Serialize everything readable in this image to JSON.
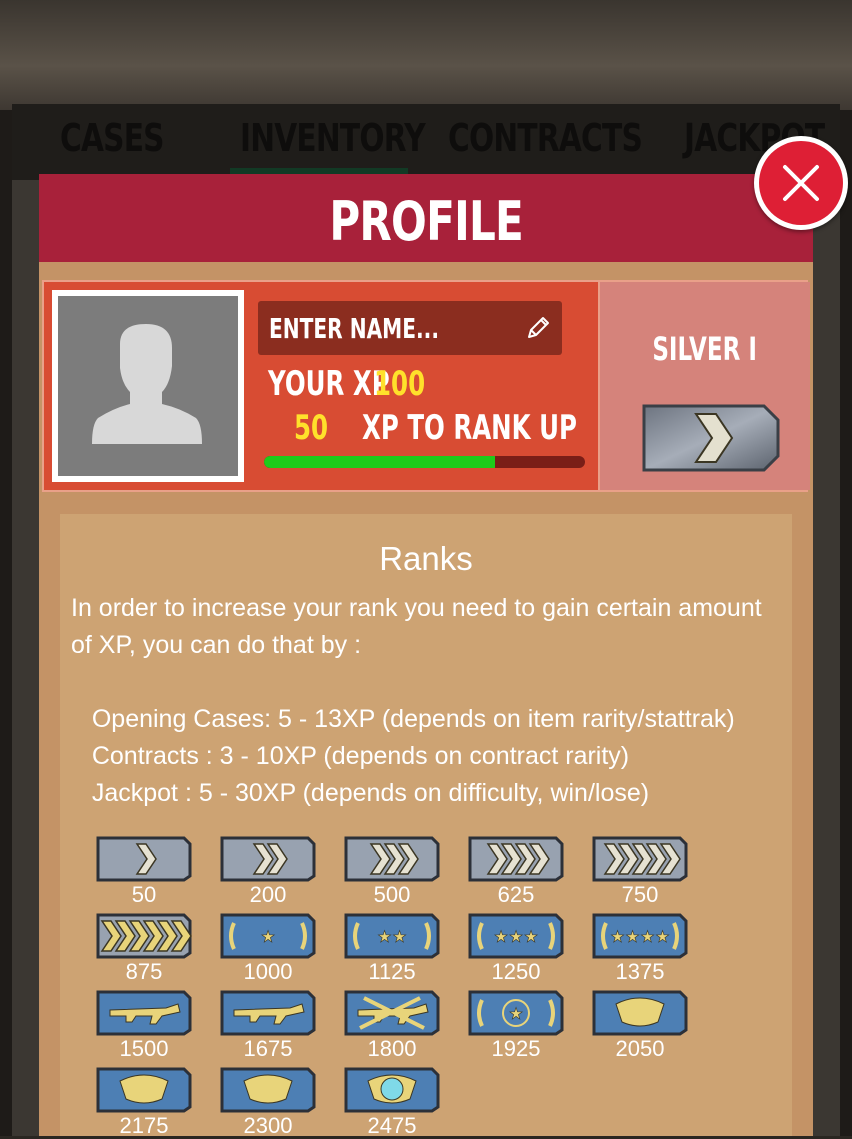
{
  "tabs": [
    {
      "label": "CASES"
    },
    {
      "label": "INVENTORY"
    },
    {
      "label": "CONTRACTS"
    },
    {
      "label": "JACKPOT"
    }
  ],
  "header": {
    "title": "PROFILE"
  },
  "profile": {
    "name_placeholder": "ENTER NAME...",
    "xp_label": "YOUR XP",
    "xp_value": "100",
    "xp_to_rank_value": "50",
    "xp_to_rank_label": "XP TO RANK UP",
    "progress": 0.72,
    "rank_name": "SILVER I",
    "rank_emblem": "single-chevron"
  },
  "ranks": {
    "title": "Ranks",
    "description": "In order to increase your rank you need to gain certain amount of XP, you can do that by :\n\n   Opening Cases: 5 - 13XP (depends on item rarity/stattrak)\n   Contracts : 3 - 10XP (depends on contract rarity)\n   Jackpot : 5 - 30XP (depends on difficulty, win/lose)",
    "list": [
      {
        "xp": "50",
        "emblem": "chevron-1"
      },
      {
        "xp": "200",
        "emblem": "chevron-2"
      },
      {
        "xp": "500",
        "emblem": "chevron-3"
      },
      {
        "xp": "625",
        "emblem": "chevron-4"
      },
      {
        "xp": "750",
        "emblem": "chevron-5"
      },
      {
        "xp": "875",
        "emblem": "chevron-6-gold"
      },
      {
        "xp": "1000",
        "emblem": "star-1"
      },
      {
        "xp": "1125",
        "emblem": "star-2"
      },
      {
        "xp": "1250",
        "emblem": "star-3"
      },
      {
        "xp": "1375",
        "emblem": "star-4"
      },
      {
        "xp": "1500",
        "emblem": "ak-1"
      },
      {
        "xp": "1675",
        "emblem": "ak-2"
      },
      {
        "xp": "1800",
        "emblem": "crossed-rifles"
      },
      {
        "xp": "1925",
        "emblem": "star-medal"
      },
      {
        "xp": "2050",
        "emblem": "eagle-1"
      },
      {
        "xp": "2175",
        "emblem": "eagle-2"
      },
      {
        "xp": "2300",
        "emblem": "wings"
      },
      {
        "xp": "2475",
        "emblem": "globe"
      }
    ]
  },
  "colors": {
    "header": "#a8213a",
    "card": "#d84c33",
    "accent_yellow": "#ffe12b",
    "progress": "#1ecb1a",
    "close": "#de1f35"
  }
}
